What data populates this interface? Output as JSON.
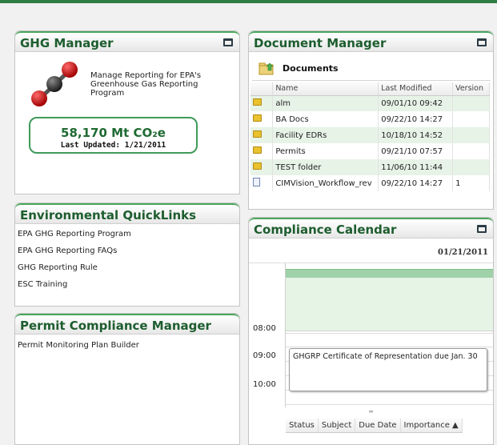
{
  "ghg": {
    "title": "GHG Manager",
    "description": "Manage Reporting for EPA's Greenhouse Gas Reporting Program",
    "value": "58,170 Mt CO₂e",
    "updated": "Last Updated: 1/21/2011"
  },
  "quicklinks": {
    "title": "Environmental QuickLinks",
    "items": [
      "EPA GHG Reporting Program",
      "EPA GHG Reporting FAQs",
      "GHG Reporting Rule",
      "ESC Training"
    ]
  },
  "permit": {
    "title": "Permit Compliance Manager",
    "items": [
      "Permit Monitoring Plan Builder"
    ]
  },
  "docs": {
    "title": "Document Manager",
    "toolbar_title": "Documents",
    "columns": [
      "Name",
      "Last Modified",
      "Version"
    ],
    "rows": [
      {
        "icon": "folder-icon",
        "name": "alm",
        "modified": "09/01/10 09:42",
        "version": ""
      },
      {
        "icon": "folder-icon",
        "name": "BA Docs",
        "modified": "09/22/10 14:27",
        "version": ""
      },
      {
        "icon": "folder-icon",
        "name": "Facility EDRs",
        "modified": "10/18/10 14:52",
        "version": ""
      },
      {
        "icon": "folder-icon",
        "name": "Permits",
        "modified": "09/21/10 07:57",
        "version": ""
      },
      {
        "icon": "folder-icon",
        "name": "TEST folder",
        "modified": "11/06/10 11:44",
        "version": ""
      },
      {
        "icon": "file-icon",
        "name": "CIMVision_Workflow_rev",
        "modified": "09/22/10 14:27",
        "version": "1"
      }
    ]
  },
  "calendar": {
    "title": "Compliance Calendar",
    "date": "01/21/2011",
    "times": [
      "08:00",
      "09:00",
      "10:00"
    ],
    "event": "GHGRP Certificate of Representation due Jan. 30",
    "splitter": "═",
    "task_columns": [
      "Status",
      "Subject",
      "Due Date",
      "Importance ▲"
    ]
  },
  "colors": {
    "accent": "#1d5d2e",
    "rule": "#2e7d42",
    "row_alt": "#e8f3e8",
    "calendar_fill": "#e6f4e6"
  }
}
